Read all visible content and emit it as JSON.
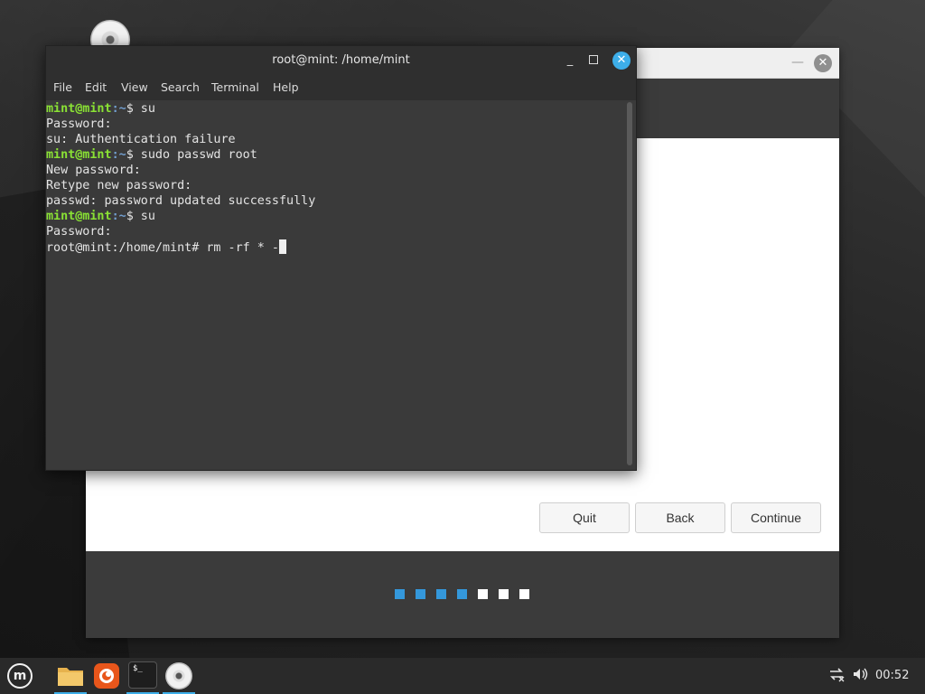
{
  "terminal": {
    "title": "root@mint: /home/mint",
    "menu": [
      "File",
      "Edit",
      "View",
      "Search",
      "Terminal",
      "Help"
    ],
    "prompt_user": "mint@mint",
    "prompt_path": ":~",
    "lines": [
      {
        "type": "prompt",
        "cmd": "$ su"
      },
      {
        "type": "text",
        "text": "Password:"
      },
      {
        "type": "text",
        "text": "su: Authentication failure"
      },
      {
        "type": "prompt",
        "cmd": "$ sudo passwd root"
      },
      {
        "type": "text",
        "text": "New password:"
      },
      {
        "type": "text",
        "text": "Retype new password:"
      },
      {
        "type": "text",
        "text": "passwd: password updated successfully"
      },
      {
        "type": "prompt",
        "cmd": "$ su"
      },
      {
        "type": "text",
        "text": "Password:"
      },
      {
        "type": "text",
        "text": "root@mint:/home/mint# rm -rf * -"
      }
    ]
  },
  "installer": {
    "buttons": {
      "quit": "Quit",
      "back": "Back",
      "continue": "Continue"
    },
    "progress": {
      "total": 7,
      "completed": 4,
      "active_color": "#3498db",
      "inactive_color": "#ffffff"
    }
  },
  "taskbar": {
    "apps": [
      "menu",
      "files",
      "firefox",
      "terminal",
      "disc"
    ],
    "clock": "00:52"
  },
  "colors": {
    "accent": "#3daee9",
    "prompt_green": "#8ae234",
    "prompt_blue": "#729fcf"
  }
}
